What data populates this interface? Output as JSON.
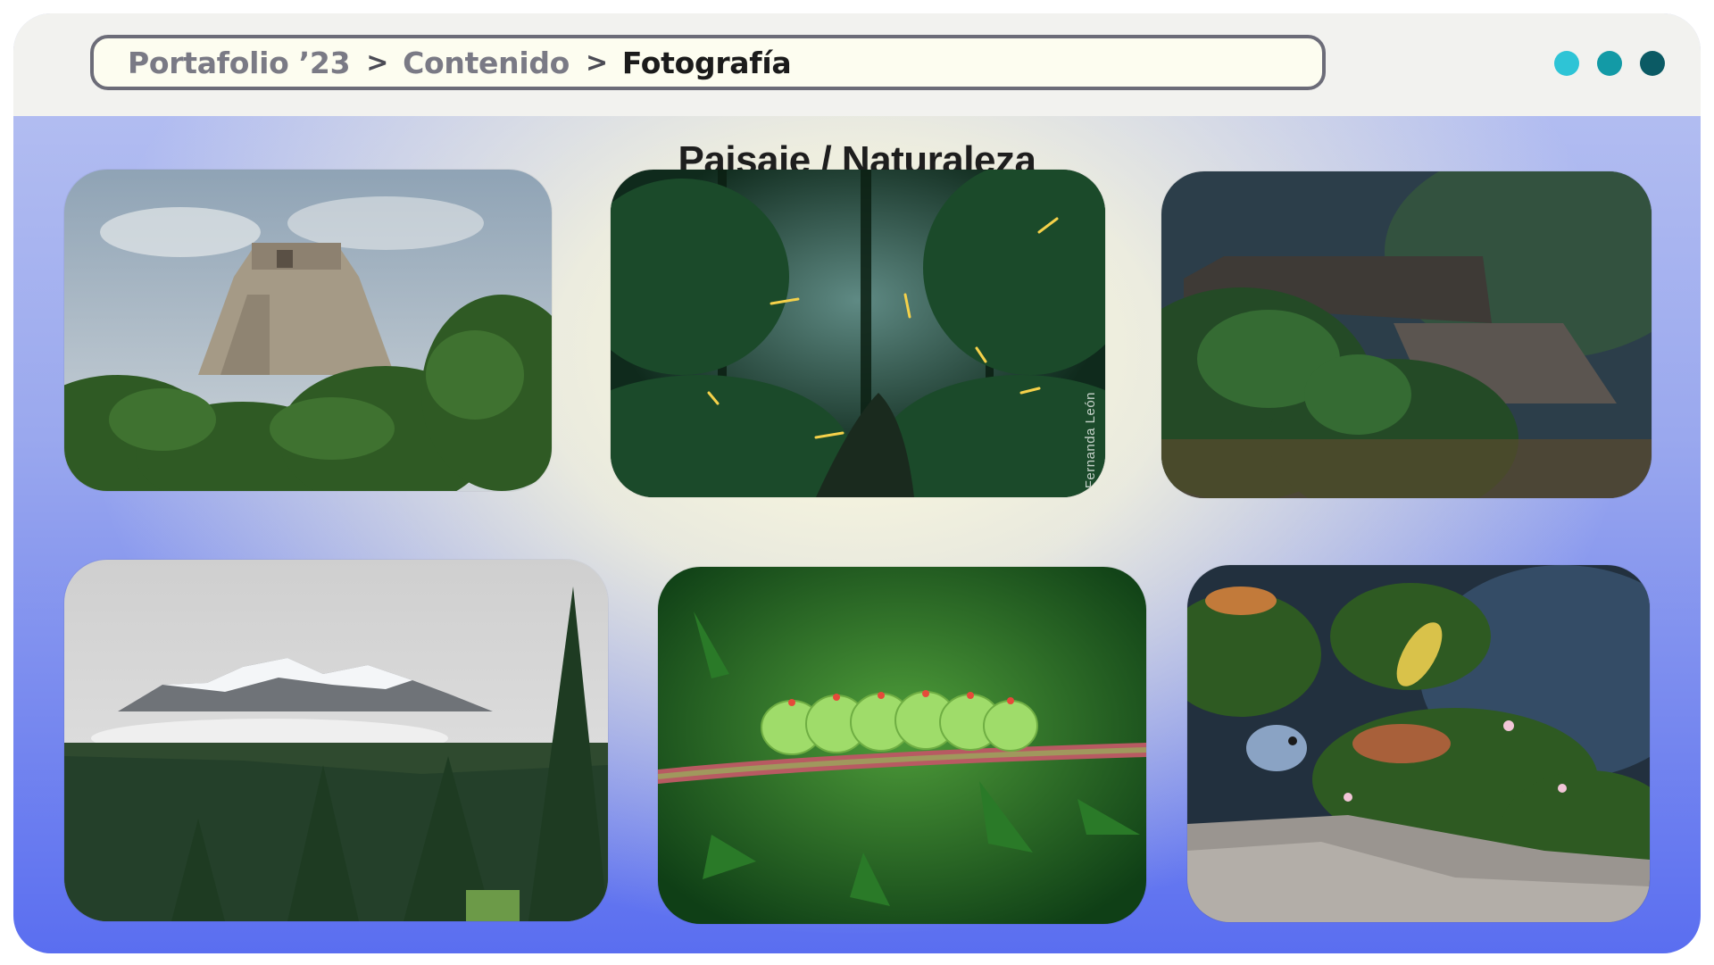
{
  "breadcrumb": {
    "items": [
      "Portafolio ’23",
      "Contenido",
      "Fotografía"
    ],
    "separator": ">"
  },
  "window_dots": {
    "colors": [
      "#2ec4d6",
      "#139aa6",
      "#0b5a64"
    ]
  },
  "section": {
    "title": "Paisaje / Naturaleza"
  },
  "gallery": {
    "photos": [
      {
        "subject": "pyramid-ruins"
      },
      {
        "subject": "forest-fireflies",
        "credit": "Fernanda León"
      },
      {
        "subject": "stone-ruins-hillside"
      },
      {
        "subject": "snowy-volcano-forest"
      },
      {
        "subject": "green-caterpillar"
      },
      {
        "subject": "small-bird-plants"
      }
    ]
  }
}
